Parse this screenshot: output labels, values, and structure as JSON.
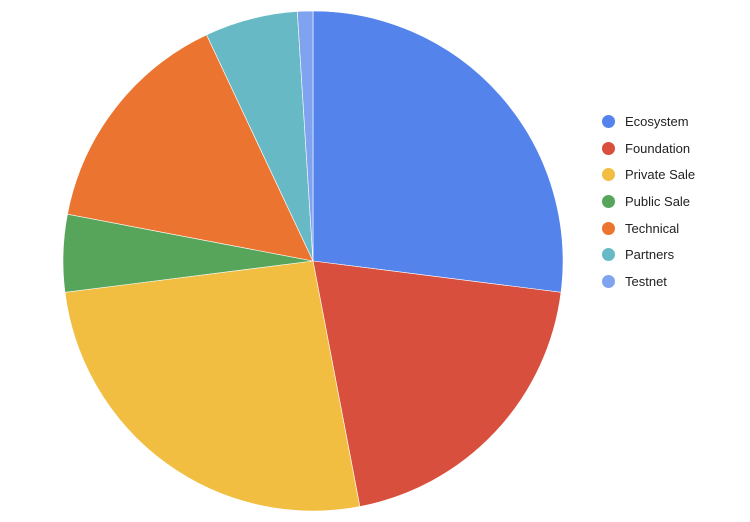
{
  "chart_data": {
    "type": "pie",
    "title": "",
    "start_angle": "top (12 o'clock), clockwise",
    "legend_position": "right",
    "slices": [
      {
        "label": "Ecosystem",
        "value": 27,
        "color": "#5383EB"
      },
      {
        "label": "Foundation",
        "value": 20,
        "color": "#D94F3E"
      },
      {
        "label": "Private Sale",
        "value": 26,
        "color": "#F1BE42"
      },
      {
        "label": "Public Sale",
        "value": 5,
        "color": "#57A55B"
      },
      {
        "label": "Technical",
        "value": 15,
        "color": "#EB7530"
      },
      {
        "label": "Partners",
        "value": 6,
        "color": "#67BAC5"
      },
      {
        "label": "Testnet",
        "value": 1,
        "color": "#7FA3EF"
      }
    ]
  },
  "legend": {
    "items": [
      {
        "label": "Ecosystem",
        "color": "#5383EB"
      },
      {
        "label": "Foundation",
        "color": "#D94F3E"
      },
      {
        "label": "Private Sale",
        "color": "#F1BE42"
      },
      {
        "label": "Public Sale",
        "color": "#57A55B"
      },
      {
        "label": "Technical",
        "color": "#EB7530"
      },
      {
        "label": "Partners",
        "color": "#67BAC5"
      },
      {
        "label": "Testnet",
        "color": "#7FA3EF"
      }
    ]
  }
}
